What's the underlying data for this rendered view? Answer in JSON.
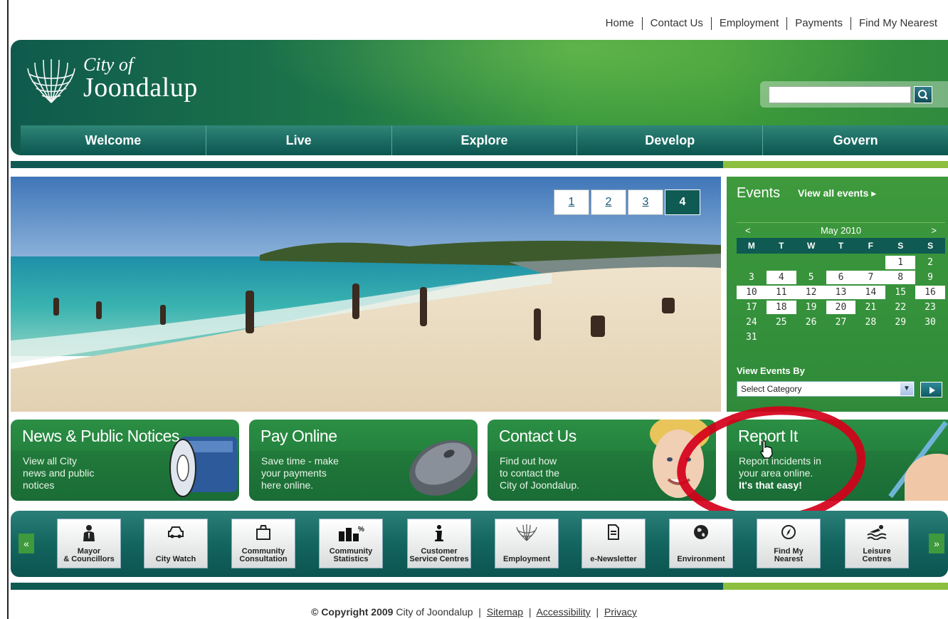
{
  "toplinks": [
    "Home",
    "Contact Us",
    "Employment",
    "Payments",
    "Find My Nearest"
  ],
  "header": {
    "logo_line1": "City of",
    "logo_line2": "Joondalup",
    "search_placeholder": ""
  },
  "mainnav": [
    "Welcome",
    "Live",
    "Explore",
    "Develop",
    "Govern"
  ],
  "hero": {
    "pages": [
      "1",
      "2",
      "3",
      "4"
    ],
    "active_page": "4"
  },
  "events": {
    "title": "Events",
    "view_all": "View all events ▸",
    "prev": "<",
    "next": ">",
    "month": "May 2010",
    "weekdays": [
      "M",
      "T",
      "W",
      "T",
      "F",
      "S",
      "S"
    ],
    "view_by": "View Events By",
    "select_value": "Select Category"
  },
  "tiles": [
    {
      "title": "News & Public Notices",
      "desc": "View all City\nnews and public\nnotices",
      "bold": ""
    },
    {
      "title": "Pay Online",
      "desc": "Save time - make\nyour payments\nhere online.",
      "bold": ""
    },
    {
      "title": "Contact Us",
      "desc": "Find out how\nto contact the\nCity of Joondalup.",
      "bold": ""
    },
    {
      "title": "Report It",
      "desc": "Report incidents in\nyour area online.",
      "bold": "It's that easy!"
    }
  ],
  "quicklinks": [
    {
      "label": "Mayor\n& Councillors",
      "icon": "person-icon"
    },
    {
      "label": "City Watch",
      "icon": "car-icon"
    },
    {
      "label": "Community\nConsultation",
      "icon": "bag-icon"
    },
    {
      "label": "Community\nStatistics",
      "icon": "bar-chart-icon"
    },
    {
      "label": "Customer\nService Centres",
      "icon": "info-icon"
    },
    {
      "label": "Employment",
      "icon": "logo-icon"
    },
    {
      "label": "e-Newsletter",
      "icon": "document-icon"
    },
    {
      "label": "Environment",
      "icon": "globe-icon"
    },
    {
      "label": "Find My\nNearest",
      "icon": "compass-icon"
    },
    {
      "label": "Leisure\nCentres",
      "icon": "swimmer-icon"
    }
  ],
  "footer": {
    "copyright_bold": "© Copyright 2009",
    "copyright_rest": "City of Joondalup",
    "links": [
      "Sitemap",
      "Accessibility",
      "Privacy"
    ]
  },
  "colors": {
    "brand_dark": "#0f5a52",
    "brand_green": "#3e9a3c",
    "accent_lime": "#8cbf3f",
    "annotation_red": "#d4001a"
  }
}
